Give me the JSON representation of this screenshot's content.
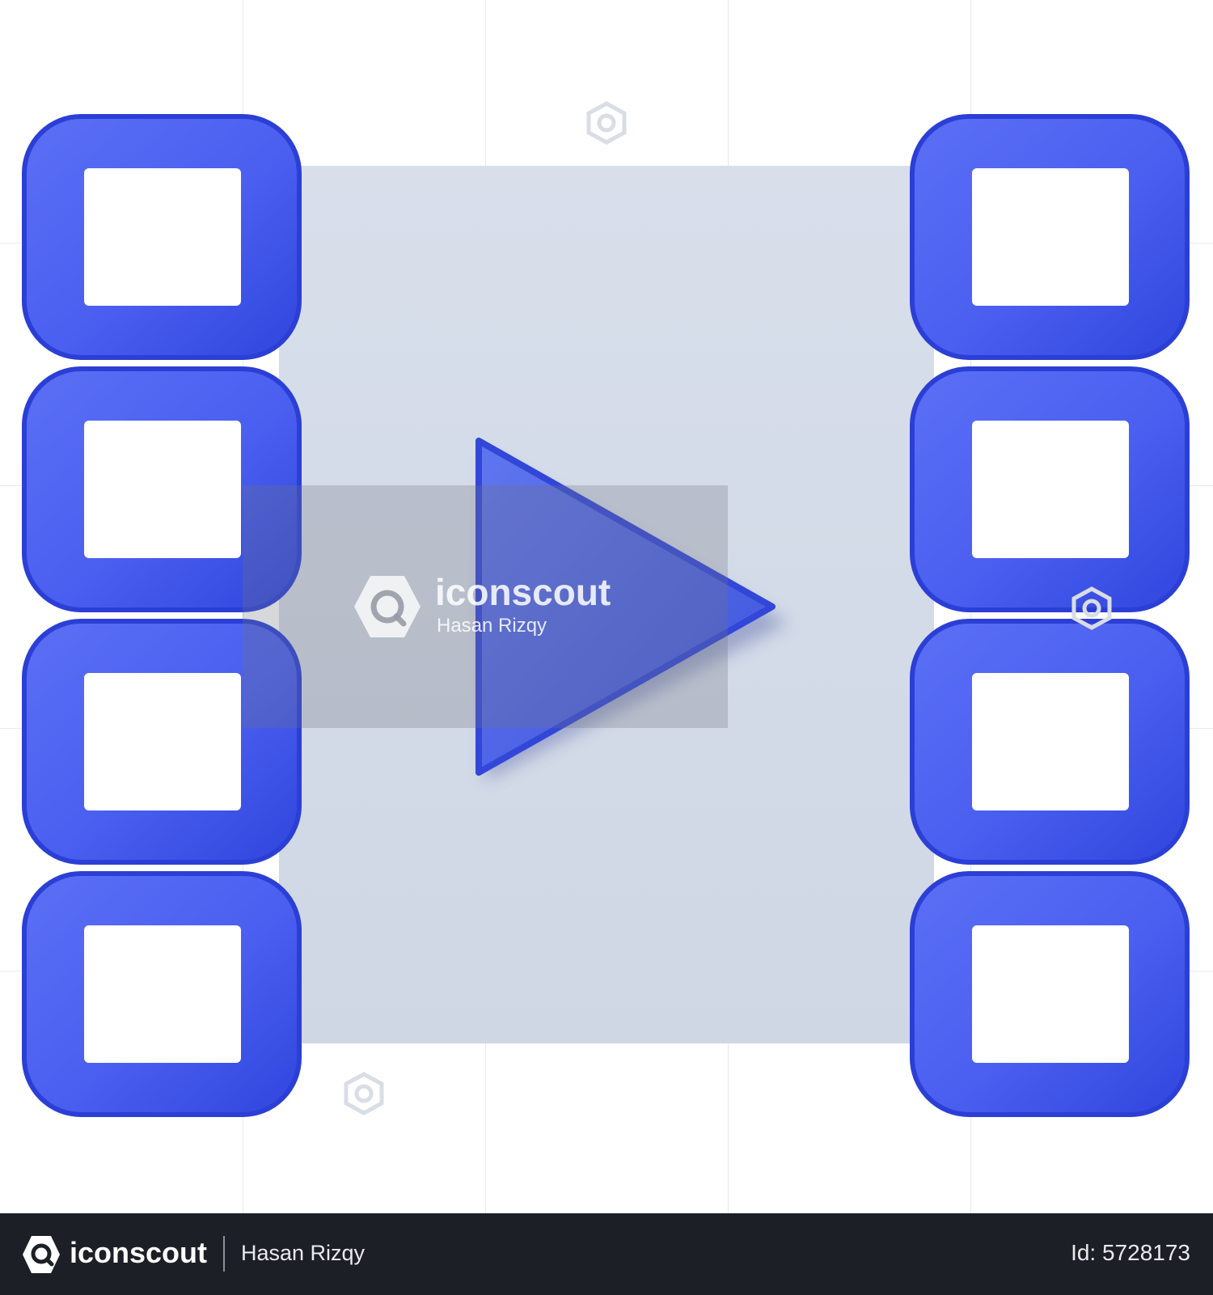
{
  "watermark": {
    "brand": "iconscout",
    "author": "Hasan Rizqy"
  },
  "footer": {
    "brand": "iconscout",
    "author": "Hasan Rizqy",
    "asset_id": "Id: 5728173"
  },
  "colors": {
    "film_blue": "#4a5ff0",
    "film_blue_dark": "#2b3fd6",
    "film_center": "#d3dbe8",
    "play_triangle": "#5468e0",
    "footer_bg": "#1c1f26"
  },
  "icons": [
    "film-strip-icon",
    "play-icon",
    "iconscout-logo-icon"
  ]
}
